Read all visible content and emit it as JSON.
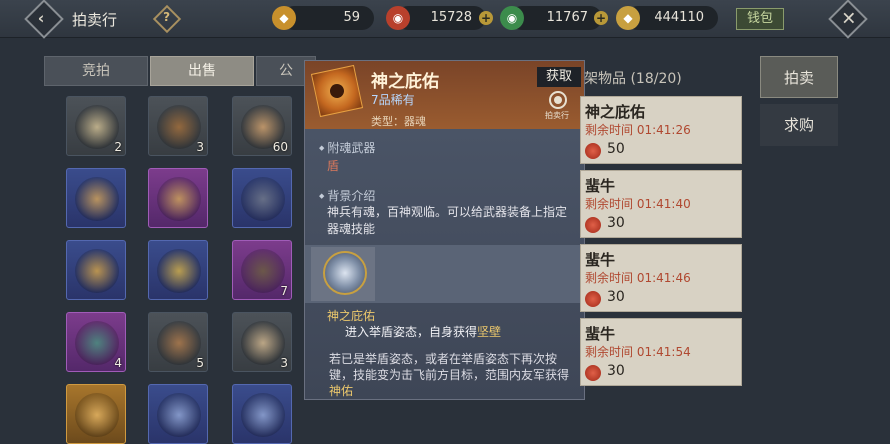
{
  "header": {
    "title": "拍卖行",
    "help_glyph": "?",
    "currencies": [
      {
        "name": "coin-bag-icon",
        "value": "59",
        "color": "#c8902c"
      },
      {
        "name": "red-gem-icon",
        "value": "15728",
        "color": "#b8402c"
      },
      {
        "name": "green-gem-icon",
        "value": "11767",
        "color": "#3c8c4c"
      },
      {
        "name": "gold-ingot-icon",
        "value": "444110",
        "color": "#c8a040"
      }
    ],
    "money_label": "钱包",
    "close_glyph": "✕",
    "back_glyph": "‹"
  },
  "tabs": [
    {
      "label": "竞拍",
      "active": false
    },
    {
      "label": "出售",
      "active": true
    },
    {
      "label": "公",
      "active": false
    }
  ],
  "inventory": [
    {
      "icon": "bull-skull-icon",
      "quality": "grey",
      "count": "2",
      "color": "#c8b890"
    },
    {
      "icon": "rope-coil-icon",
      "quality": "grey",
      "count": "3",
      "color": "#9c6c3c"
    },
    {
      "icon": "hide-scrap-icon",
      "quality": "grey",
      "count": "60",
      "color": "#c89c6c"
    },
    {
      "icon": "pipa-instrument-icon",
      "quality": "blue",
      "count": "",
      "color": "#c89c5c"
    },
    {
      "icon": "pipa-instrument-icon",
      "quality": "purple",
      "count": "",
      "color": "#c89c5c"
    },
    {
      "icon": "chain-whip-icon",
      "quality": "blue",
      "count": "",
      "color": "#6c7488"
    },
    {
      "icon": "ornate-medallion-icon",
      "quality": "blue",
      "count": "",
      "color": "#c89c4c"
    },
    {
      "icon": "ornate-medallion-icon",
      "quality": "blue",
      "count": "",
      "color": "#c8a84c"
    },
    {
      "icon": "leather-pouch-icon",
      "quality": "purple",
      "count": "7",
      "color": "#6c5c44"
    },
    {
      "icon": "teal-cloth-icon",
      "quality": "purple",
      "count": "4",
      "color": "#4c8c80"
    },
    {
      "icon": "bronze-bowl-icon",
      "quality": "grey",
      "count": "5",
      "color": "#a8784c"
    },
    {
      "icon": "herb-bundle-icon",
      "quality": "grey",
      "count": "3",
      "color": "#c8b08c"
    },
    {
      "icon": "scroll-icon",
      "quality": "gold",
      "count": "",
      "color": "#e0b060"
    },
    {
      "icon": "scroll-icon",
      "quality": "blue",
      "count": "",
      "color": "#8ca0d0"
    },
    {
      "icon": "scroll-icon",
      "quality": "blue",
      "count": "",
      "color": "#8ca0d0"
    }
  ],
  "popup": {
    "name": "神之庇佑",
    "rarity": "7品稀有",
    "type": "类型：器魂",
    "obtain_label": "获取",
    "auction_label": "拍卖行",
    "weapon_title": "附魂武器",
    "weapon_value": "盾",
    "bg_title": "背景介绍",
    "bg_text": "神兵有魂，百神观临。可以给武器装备上指定器魂技能",
    "skill_name": "神之庇佑",
    "skill_desc_pre": "进入举盾姿态，自身获得",
    "skill_desc_hl": "坚壁",
    "skill_long_pre": "若已是举盾姿态，或者在举盾姿态下再次按键，技能变为击飞前方目标，范围内友军获得",
    "skill_long_hl": "神佑"
  },
  "listings": {
    "header": "架物品 (18/20)",
    "items": [
      {
        "name": "神之庇佑",
        "time": "剩余时间 01:41:26",
        "price": "50"
      },
      {
        "name": "蜚牛",
        "time": "剩余时间 01:41:40",
        "price": "30"
      },
      {
        "name": "蜚牛",
        "time": "剩余时间 01:41:46",
        "price": "30"
      },
      {
        "name": "蜚牛",
        "time": "剩余时间 01:41:54",
        "price": "30"
      }
    ]
  },
  "side_tabs": [
    {
      "label": "拍卖",
      "active": true
    },
    {
      "label": "求购",
      "active": false
    }
  ]
}
